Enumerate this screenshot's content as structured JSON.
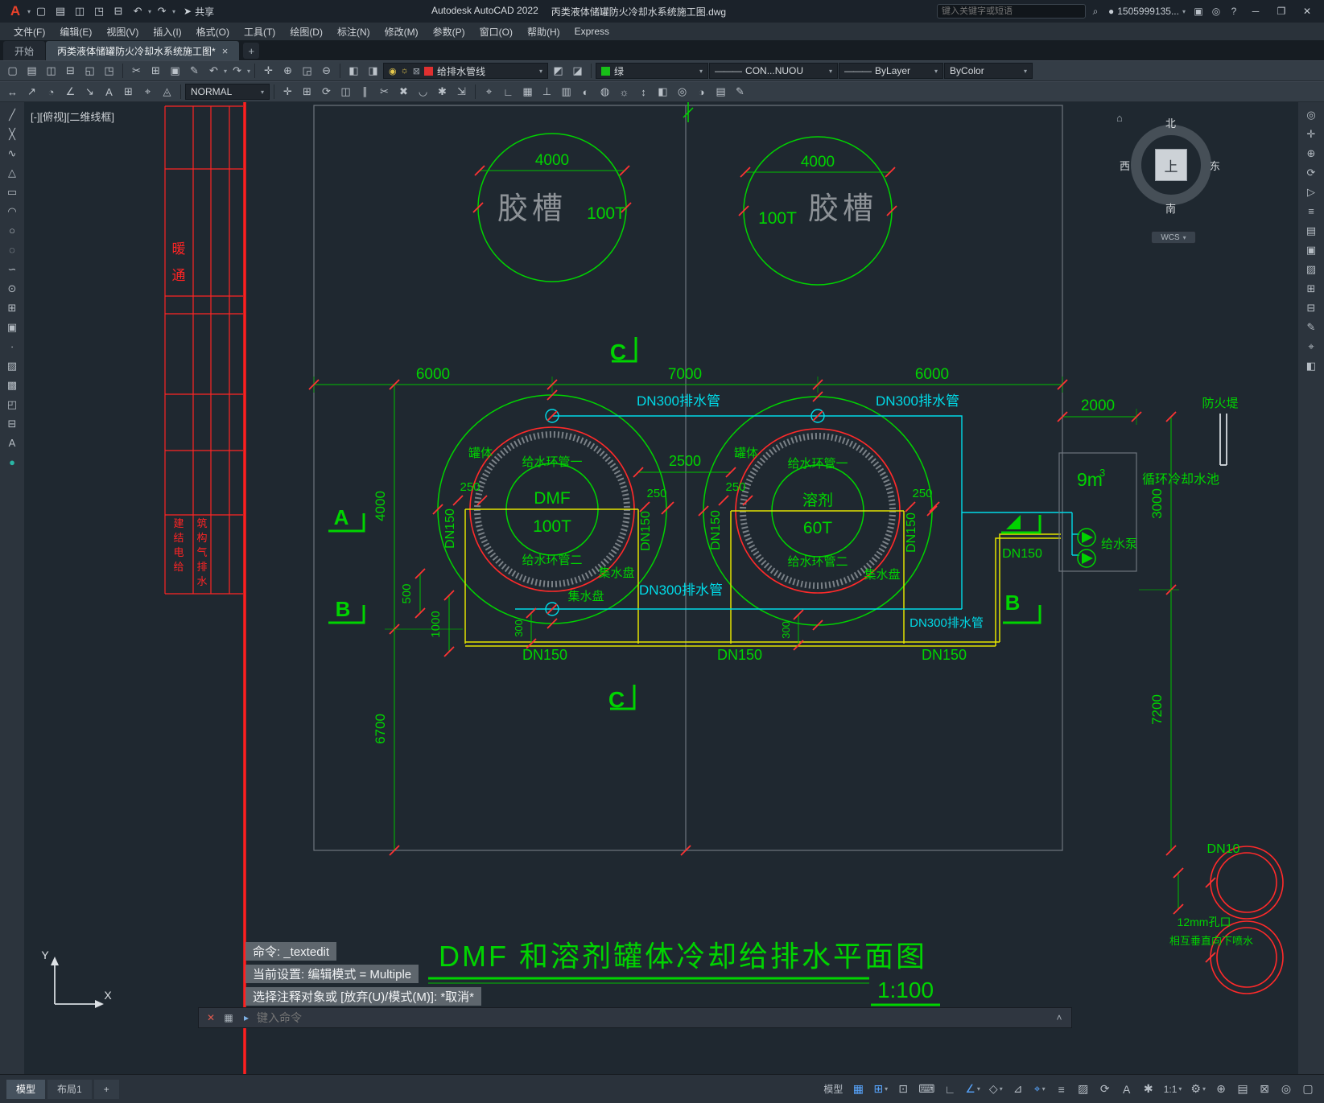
{
  "titlebar": {
    "app_title": "Autodesk AutoCAD 2022",
    "doc_title": "丙类液体储罐防火冷却水系统施工图.dwg",
    "share_label": "共享",
    "search_placeholder": "键入关键字或短语",
    "account_label": "1505999135..."
  },
  "menubar": {
    "items": [
      "文件(F)",
      "编辑(E)",
      "视图(V)",
      "插入(I)",
      "格式(O)",
      "工具(T)",
      "绘图(D)",
      "标注(N)",
      "修改(M)",
      "参数(P)",
      "窗口(O)",
      "帮助(H)",
      "Express"
    ]
  },
  "tabbar": {
    "start_tab": "开始",
    "drawing_tab": "丙类液体储罐防火冷却水系统施工图*",
    "close_glyph": "×",
    "new_tab_glyph": "+"
  },
  "toolbars": {
    "layer_value": "给排水管线",
    "color_value": "绿",
    "linetype_value": "CON...NUOU",
    "lineweight_value": "ByLayer",
    "plotstyle_value": "ByColor",
    "text_style_value": "NORMAL"
  },
  "canvas": {
    "viewport_label": "[-][俯视][二维线框]",
    "wcs_label": "WCS",
    "compass": {
      "n": "北",
      "s": "南",
      "e": "东",
      "w": "西",
      "up": "上"
    }
  },
  "drawing": {
    "glue_tank": "胶槽",
    "glue_cap": "100T",
    "dim_4000_h": "4000",
    "dim_6000": "6000",
    "dim_7000": "7000",
    "dim_2500": "2500",
    "dim_250": "250",
    "dim_4000_v": "4000",
    "dim_500": "500",
    "dim_1000": "1000",
    "dim_6700": "6700",
    "dim_300": "300",
    "dim_2000": "2000",
    "dim_3000": "3000",
    "dim_7200": "7200",
    "dn300_drain": "DN300排水管",
    "dn150": "DN150",
    "tank_shell": "罐体",
    "supply_ring_1": "给水环管一",
    "supply_ring_2": "给水环管二",
    "collect_pan": "集水盘",
    "tank1_name": "DMF",
    "tank1_cap": "100T",
    "tank2_name": "溶剂",
    "tank2_cap": "60T",
    "pool_volume": "9m",
    "pool_volume_sup": "3",
    "pool_name": "循环冷却水池",
    "pump_name": "给水泵",
    "dike_name": "防火堤",
    "dn10": "DN10",
    "hole_note": "12mm孔口",
    "spray_note": "相互垂直向下喷水",
    "section_a": "A",
    "section_b": "B",
    "section_c": "C",
    "sheet_title": "DMF 和溶剂罐体冷却给排水平面图",
    "sheet_scale": "1:100",
    "hvac_1": "暖",
    "hvac_2": "通",
    "discipline_col1": [
      "建",
      "结",
      "电",
      "给"
    ],
    "discipline_col2": [
      "筑",
      "构",
      "气",
      "排",
      "水"
    ],
    "ucs_x": "X",
    "ucs_y": "Y"
  },
  "command": {
    "history": [
      "命令: _textedit",
      "当前设置: 编辑模式 = Multiple",
      "选择注释对象或 [放弃(U)/模式(M)]: *取消*"
    ],
    "prompt": "键入命令"
  },
  "statusbar": {
    "model_tab": "模型",
    "layout1_tab": "布局1",
    "new_layout": "+",
    "model_toggle": "模型",
    "annotation_scale": "1:1"
  }
}
